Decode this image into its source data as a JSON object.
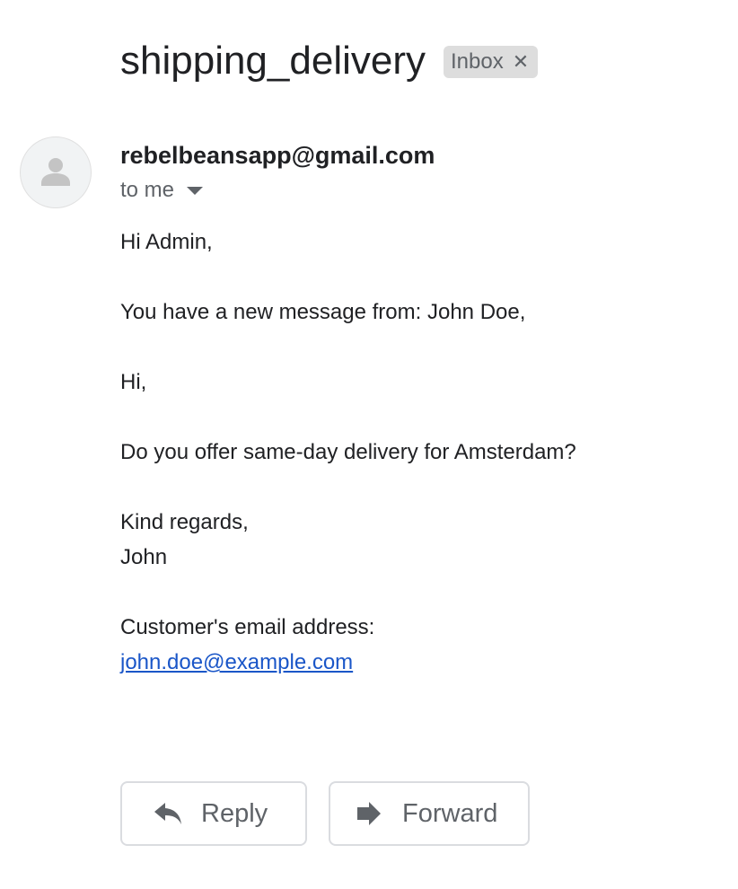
{
  "message": {
    "subject": "shipping_delivery",
    "label_chip": {
      "text": "Inbox",
      "remove_icon": "close-icon"
    },
    "sender": "rebelbeansapp@gmail.com",
    "recipient_summary": "to me",
    "body": {
      "greeting": "Hi Admin,",
      "intro": "You have a new message from: John Doe,",
      "salutation": "Hi,",
      "question": "Do you offer same-day delivery for Amsterdam?",
      "closing": "Kind regards,",
      "signature": "John",
      "email_label": "Customer's email address:",
      "email_link": "john.doe@example.com"
    }
  },
  "actions": {
    "reply_label": "Reply",
    "reply_icon": "reply-arrow-icon",
    "forward_label": "Forward",
    "forward_icon": "forward-arrow-icon"
  },
  "colors": {
    "link": "#1a56c8",
    "chip_background": "#dddddd",
    "secondary_text": "#5f6368"
  }
}
